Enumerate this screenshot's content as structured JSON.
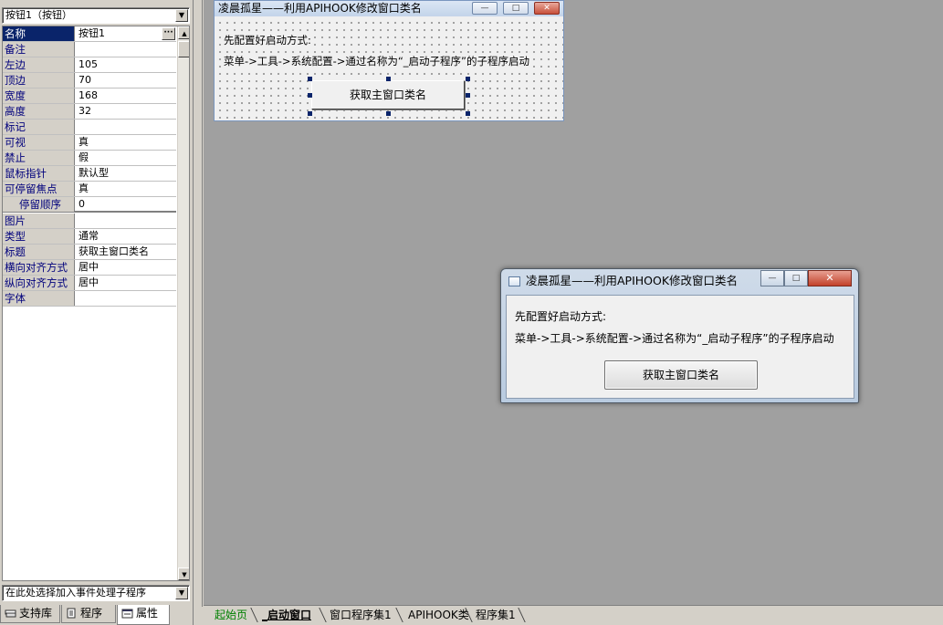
{
  "left_panel": {
    "object_select": "按钮1（按钮）",
    "event_select": "在此处选择加入事件处理子程序",
    "properties": [
      {
        "name": "名称",
        "value": "按钮1"
      },
      {
        "name": "备注",
        "value": ""
      },
      {
        "name": "左边",
        "value": "105"
      },
      {
        "name": "顶边",
        "value": "70"
      },
      {
        "name": "宽度",
        "value": "168"
      },
      {
        "name": "高度",
        "value": "32"
      },
      {
        "name": "标记",
        "value": ""
      },
      {
        "name": "可视",
        "value": "真"
      },
      {
        "name": "禁止",
        "value": "假"
      },
      {
        "name": "鼠标指针",
        "value": "默认型"
      },
      {
        "name": "可停留焦点",
        "value": "真"
      },
      {
        "name": "停留顺序",
        "value": "0"
      },
      {
        "name": "图片",
        "value": ""
      },
      {
        "name": "类型",
        "value": "通常"
      },
      {
        "name": "标题",
        "value": "获取主窗口类名"
      },
      {
        "name": "横向对齐方式",
        "value": "居中"
      },
      {
        "name": "纵向对齐方式",
        "value": "居中"
      },
      {
        "name": "字体",
        "value": ""
      }
    ],
    "ellipsis": "···",
    "tabs": [
      {
        "label": "支持库"
      },
      {
        "label": "程序"
      },
      {
        "label": "属性"
      }
    ]
  },
  "design_form": {
    "title": "凌晨孤星——利用APIHOOK修改窗口类名",
    "label1": "先配置好启动方式:",
    "label2": "菜单->工具->系统配置->通过名称为“_启动子程序”的子程序启动",
    "button": "获取主窗口类名",
    "min_glyph": "—",
    "max_glyph": "□",
    "close_glyph": "✕"
  },
  "runtime_window": {
    "title": "凌晨孤星——利用APIHOOK修改窗口类名",
    "label1": "先配置好启动方式:",
    "label2": "菜单->工具->系统配置->通过名称为“_启动子程序”的子程序启动",
    "button": "获取主窗口类名",
    "min_glyph": "—",
    "max_glyph": "□",
    "close_glyph": "✕"
  },
  "workspace_tabs": [
    {
      "label": "起始页"
    },
    {
      "label": "_启动窗口"
    },
    {
      "label": "窗口程序集1"
    },
    {
      "label": "APIHOOK类"
    },
    {
      "label": "程序集1"
    }
  ],
  "colors": {
    "workspace_bg": "#a0a0a0",
    "selected_row": "#0a246a",
    "property_name_text": "#00007c",
    "start_tab": "#008000"
  }
}
